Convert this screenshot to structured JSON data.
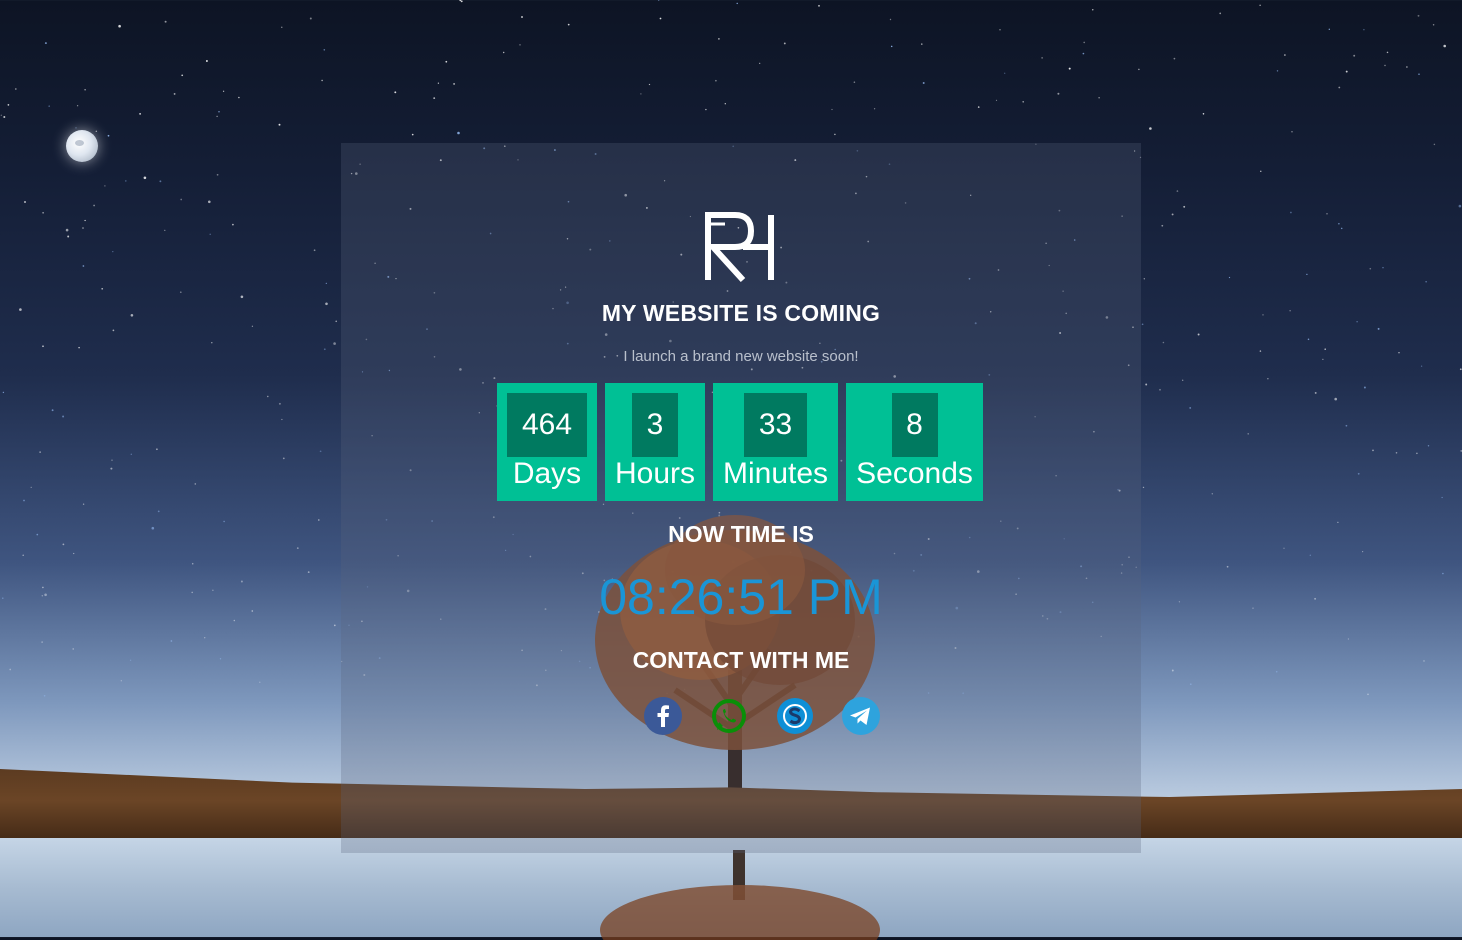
{
  "page": {
    "title": "MY WEBSITE IS COMING",
    "subtitle": "I launch a brand new website soon!"
  },
  "countdown": [
    {
      "value": "464",
      "label": "Days"
    },
    {
      "value": "3",
      "label": "Hours"
    },
    {
      "value": "33",
      "label": "Minutes"
    },
    {
      "value": "8",
      "label": "Seconds"
    }
  ],
  "now": {
    "label": "NOW TIME IS",
    "time": "08:26:51 PM"
  },
  "contact": {
    "label": "CONTACT WITH ME",
    "links": [
      {
        "name": "facebook-icon",
        "color": "#3b5998"
      },
      {
        "name": "whatsapp-icon",
        "color": "#0a8f08"
      },
      {
        "name": "skype-icon",
        "color": "#0e8fd6"
      },
      {
        "name": "telegram-icon",
        "color": "#2ea3dd"
      }
    ]
  },
  "colors": {
    "countdown_box": "#00c095",
    "countdown_number_bg": "#007a60",
    "clock": "#1a95d6"
  }
}
